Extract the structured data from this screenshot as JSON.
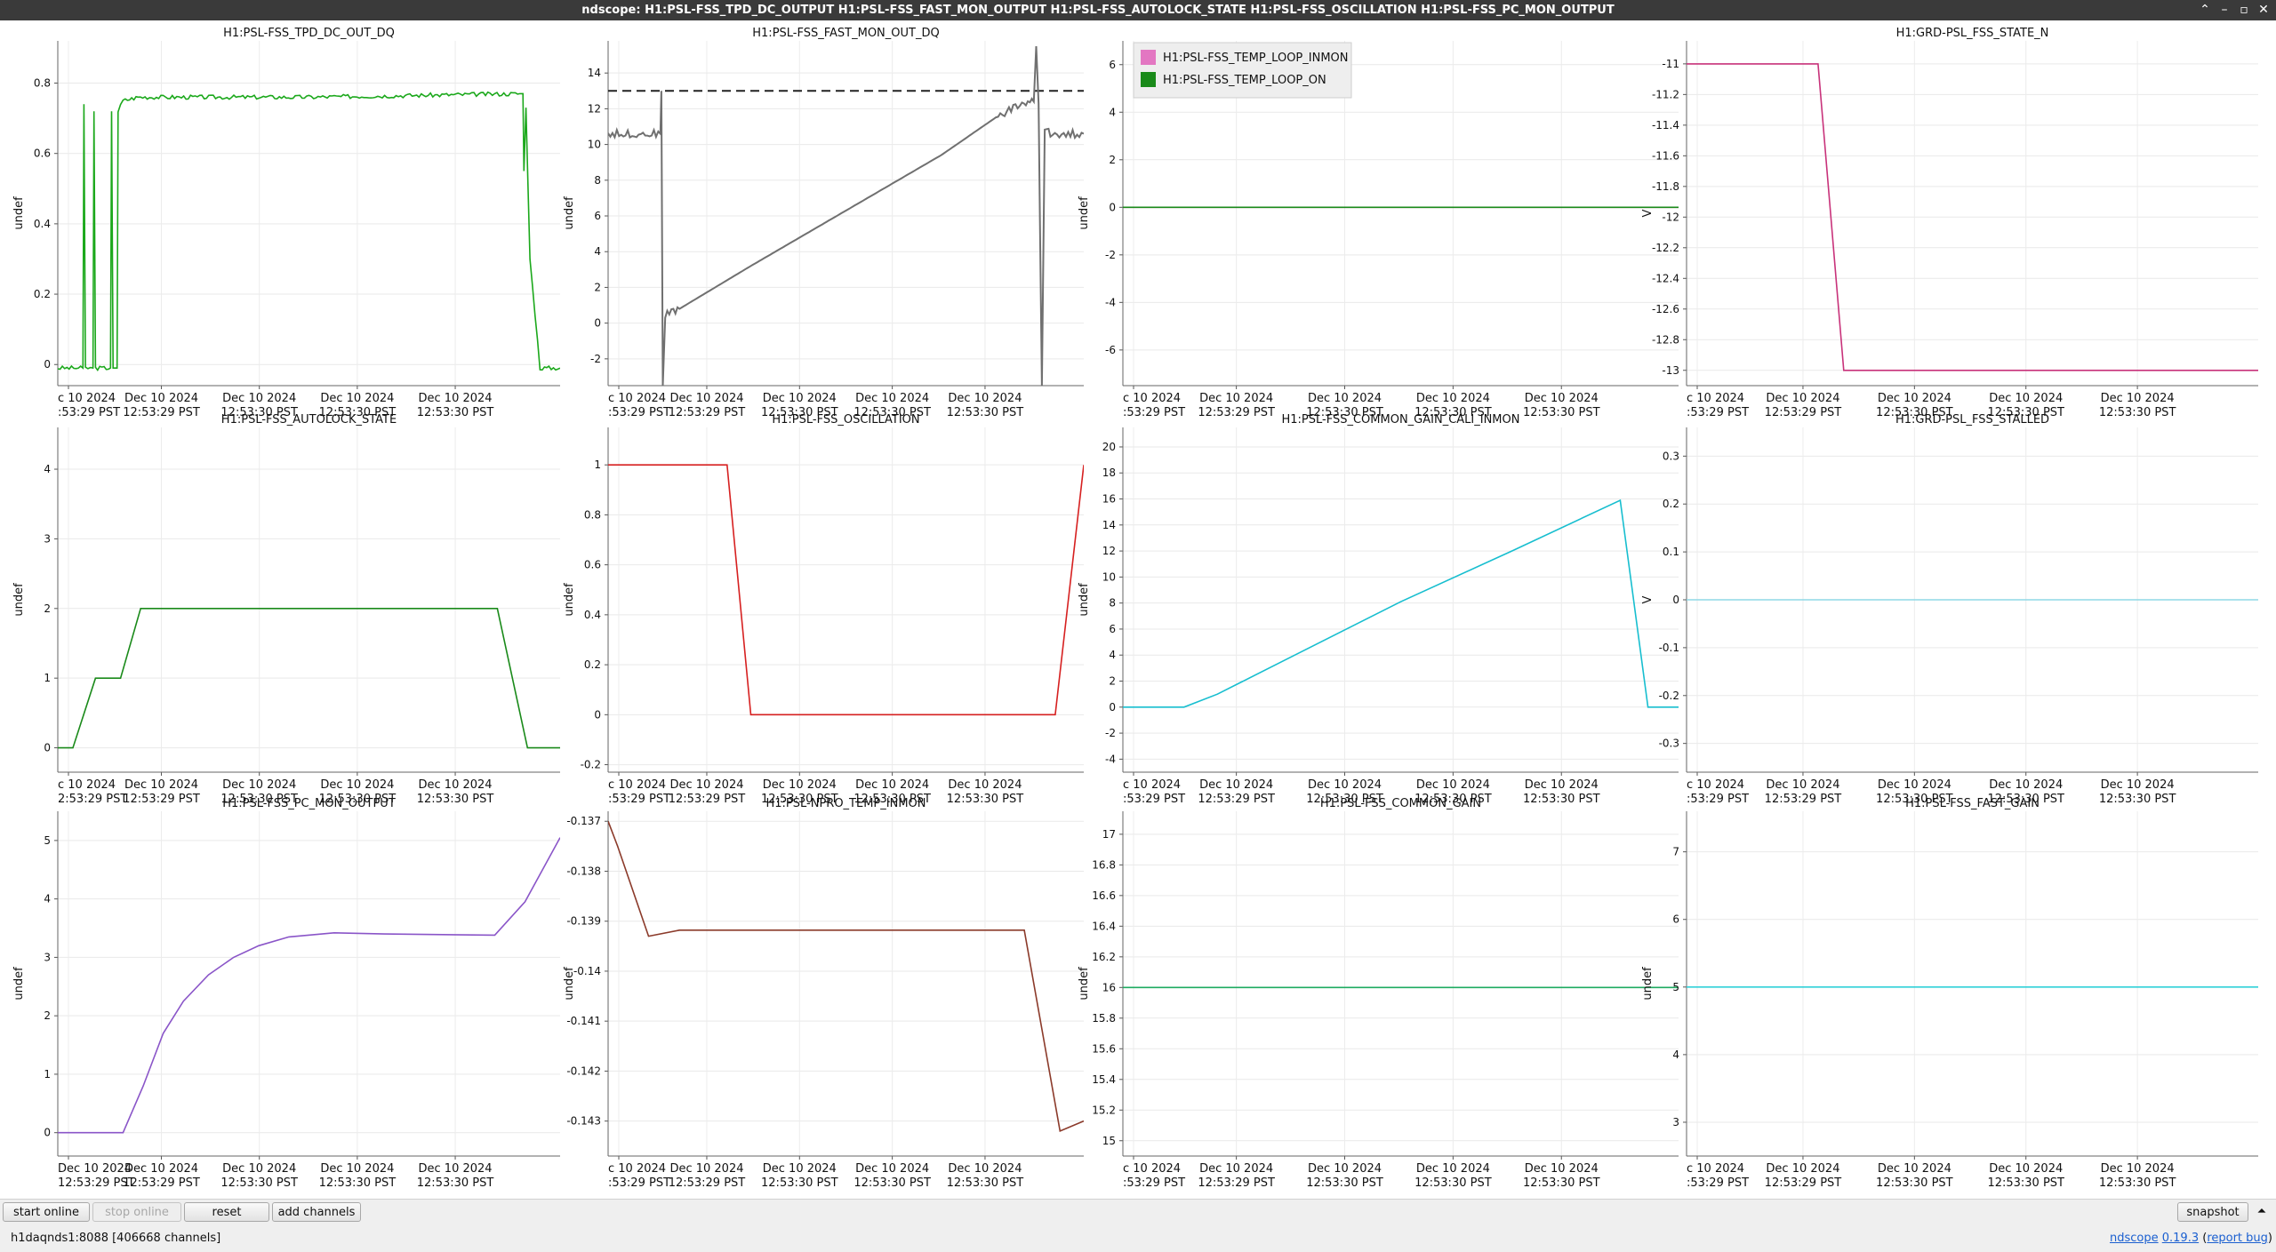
{
  "window": {
    "title": "ndscope: H1:PSL-FSS_TPD_DC_OUTPUT H1:PSL-FSS_FAST_MON_OUTPUT H1:PSL-FSS_AUTOLOCK_STATE H1:PSL-FSS_OSCILLATION H1:PSL-FSS_PC_MON_OUTPUT",
    "controls": [
      "⌃",
      "–",
      "▫",
      "✕"
    ]
  },
  "plots": [
    {
      "title": "H1:PSL-FSS_TPD_DC_OUT_DQ",
      "ylabel": "undef",
      "yrange": [
        -0.06,
        0.92
      ],
      "yticks": [
        "0",
        "0.2",
        "0.4",
        "0.6",
        "0.8"
      ],
      "xticks": [
        {
          "l1": "c 10 2024",
          "l2": ":53:29 PST"
        },
        {
          "l1": "Dec 10 2024",
          "l2": "12:53:29 PST"
        },
        {
          "l1": "Dec 10 2024",
          "l2": "12:53:30 PST"
        },
        {
          "l1": "Dec 10 2024",
          "l2": "12:53:30 PST"
        },
        {
          "l1": "Dec 10 2024",
          "l2": "12:53:30 PST"
        }
      ],
      "series": [
        {
          "color": "#1ba81b",
          "noise": 0.006,
          "points": [
            [
              0,
              -0.01
            ],
            [
              0.05,
              -0.01
            ],
            [
              0.052,
              0.74
            ],
            [
              0.055,
              -0.01
            ],
            [
              0.07,
              -0.01
            ],
            [
              0.072,
              0.72
            ],
            [
              0.075,
              -0.01
            ],
            [
              0.105,
              -0.01
            ],
            [
              0.107,
              0.72
            ],
            [
              0.11,
              -0.01
            ],
            [
              0.118,
              -0.01
            ],
            [
              0.12,
              0.72
            ],
            [
              0.13,
              0.75
            ],
            [
              0.16,
              0.76
            ],
            [
              0.5,
              0.76
            ],
            [
              0.92,
              0.77
            ],
            [
              0.926,
              0.77
            ],
            [
              0.928,
              0.55
            ],
            [
              0.932,
              0.73
            ],
            [
              0.94,
              0.3
            ],
            [
              0.96,
              -0.01
            ],
            [
              1.0,
              -0.01
            ]
          ]
        }
      ]
    },
    {
      "title": "H1:PSL-FSS_FAST_MON_OUT_DQ",
      "ylabel": "undef",
      "yrange": [
        -3.5,
        15.8
      ],
      "yticks": [
        "-2",
        "0",
        "2",
        "4",
        "6",
        "8",
        "10",
        "12",
        "14"
      ],
      "xticks": [
        {
          "l1": "c 10 2024",
          "l2": ":53:29 PST"
        },
        {
          "l1": "Dec 10 2024",
          "l2": "12:53:29 PST"
        },
        {
          "l1": "Dec 10 2024",
          "l2": "12:53:30 PST"
        },
        {
          "l1": "Dec 10 2024",
          "l2": "12:53:30 PST"
        },
        {
          "l1": "Dec 10 2024",
          "l2": "12:53:30 PST"
        }
      ],
      "hline": {
        "value": 13,
        "color": "#222222"
      },
      "series": [
        {
          "color": "#707070",
          "noise": 0.22,
          "points": [
            [
              0,
              10.6
            ],
            [
              0.11,
              10.6
            ],
            [
              0.112,
              13.0
            ],
            [
              0.115,
              -3.5
            ],
            [
              0.12,
              0.5
            ],
            [
              0.15,
              0.8
            ],
            [
              0.3,
              3.2
            ],
            [
              0.5,
              6.3
            ],
            [
              0.7,
              9.4
            ],
            [
              0.82,
              11.6
            ],
            [
              0.87,
              12.3
            ],
            [
              0.895,
              12.4
            ],
            [
              0.9,
              15.5
            ],
            [
              0.905,
              12.3
            ],
            [
              0.912,
              -3.5
            ],
            [
              0.918,
              10.9
            ],
            [
              0.93,
              10.6
            ],
            [
              1.0,
              10.6
            ]
          ]
        }
      ]
    },
    {
      "title": "",
      "ylabel": "undef",
      "yrange": [
        -7.5,
        7.0
      ],
      "yticks": [
        "-6",
        "-4",
        "-2",
        "0",
        "2",
        "4",
        "6"
      ],
      "xticks": [
        {
          "l1": "c 10 2024",
          "l2": ":53:29 PST"
        },
        {
          "l1": "Dec 10 2024",
          "l2": "12:53:29 PST"
        },
        {
          "l1": "Dec 10 2024",
          "l2": "12:53:30 PST"
        },
        {
          "l1": "Dec 10 2024",
          "l2": "12:53:30 PST"
        },
        {
          "l1": "Dec 10 2024",
          "l2": "12:53:30 PST"
        }
      ],
      "legend": [
        {
          "label": "H1:PSL-FSS_TEMP_LOOP_INMON",
          "color": "#e377c2"
        },
        {
          "label": "H1:PSL-FSS_TEMP_LOOP_ON",
          "color": "#1a8a1a"
        }
      ],
      "series": [
        {
          "color": "#e377c2",
          "noise": 0,
          "points": [
            [
              0,
              0
            ],
            [
              1,
              0
            ]
          ]
        },
        {
          "color": "#1a8a1a",
          "noise": 0,
          "points": [
            [
              0,
              0
            ],
            [
              1,
              0
            ]
          ]
        }
      ]
    },
    {
      "title": "H1:GRD-PSL_FSS_STATE_N",
      "ylabel": "V",
      "yrange": [
        -13.1,
        -10.85
      ],
      "yticks": [
        "-13",
        "-12.8",
        "-12.6",
        "-12.4",
        "-12.2",
        "-12",
        "-11.8",
        "-11.6",
        "-11.4",
        "-11.2",
        "-11"
      ],
      "xticks": [
        {
          "l1": "c 10 2024",
          "l2": ":53:29 PST"
        },
        {
          "l1": "Dec 10 2024",
          "l2": "12:53:29 PST"
        },
        {
          "l1": "Dec 10 2024",
          "l2": "12:53:30 PST"
        },
        {
          "l1": "Dec 10 2024",
          "l2": "12:53:30 PST"
        },
        {
          "l1": "Dec 10 2024",
          "l2": "12:53:30 PST"
        }
      ],
      "series": [
        {
          "color": "#c8327a",
          "noise": 0,
          "points": [
            [
              0,
              -11
            ],
            [
              0.23,
              -11
            ],
            [
              0.275,
              -13
            ],
            [
              1,
              -13
            ]
          ]
        }
      ]
    },
    {
      "title": "H1:PSL-FSS_AUTOLOCK_STATE",
      "ylabel": "undef",
      "yrange": [
        -0.35,
        4.6
      ],
      "yticks": [
        "0",
        "1",
        "2",
        "3",
        "4"
      ],
      "xticks": [
        {
          "l1": "c 10 2024",
          "l2": "2:53:29 PST"
        },
        {
          "l1": "Dec 10 2024",
          "l2": "12:53:29 PST"
        },
        {
          "l1": "Dec 10 2024",
          "l2": "12:53:30 PST"
        },
        {
          "l1": "Dec 10 2024",
          "l2": "12:53:30 PST"
        },
        {
          "l1": "Dec 10 2024",
          "l2": "12:53:30 PST"
        }
      ],
      "series": [
        {
          "color": "#1a8a1a",
          "noise": 0,
          "points": [
            [
              0,
              0
            ],
            [
              0.03,
              0
            ],
            [
              0.075,
              1
            ],
            [
              0.125,
              1
            ],
            [
              0.165,
              2
            ],
            [
              0.875,
              2
            ],
            [
              0.935,
              0
            ],
            [
              1,
              0
            ]
          ]
        }
      ]
    },
    {
      "title": "H1:PSL-FSS_OSCILLATION",
      "ylabel": "undef",
      "yrange": [
        -0.23,
        1.15
      ],
      "yticks": [
        "-0.2",
        "0",
        "0.2",
        "0.4",
        "0.6",
        "0.8",
        "1"
      ],
      "xticks": [
        {
          "l1": "c 10 2024",
          "l2": ":53:29 PST"
        },
        {
          "l1": "Dec 10 2024",
          "l2": "12:53:29 PST"
        },
        {
          "l1": "Dec 10 2024",
          "l2": "12:53:30 PST"
        },
        {
          "l1": "Dec 10 2024",
          "l2": "12:53:30 PST"
        },
        {
          "l1": "Dec 10 2024",
          "l2": "12:53:30 PST"
        }
      ],
      "series": [
        {
          "color": "#d62020",
          "noise": 0,
          "points": [
            [
              0,
              1
            ],
            [
              0.25,
              1
            ],
            [
              0.3,
              0
            ],
            [
              0.94,
              0
            ],
            [
              1,
              1
            ]
          ]
        }
      ]
    },
    {
      "title": "H1:PSL-FSS_COMMON_GAIN_CALI_INMON",
      "ylabel": "undef",
      "yrange": [
        -5,
        21.5
      ],
      "yticks": [
        "-4",
        "-2",
        "0",
        "2",
        "4",
        "6",
        "8",
        "10",
        "12",
        "14",
        "16",
        "18",
        "20"
      ],
      "xticks": [
        {
          "l1": "c 10 2024",
          "l2": ":53:29 PST"
        },
        {
          "l1": "Dec 10 2024",
          "l2": "12:53:29 PST"
        },
        {
          "l1": "Dec 10 2024",
          "l2": "12:53:30 PST"
        },
        {
          "l1": "Dec 10 2024",
          "l2": "12:53:30 PST"
        },
        {
          "l1": "Dec 10 2024",
          "l2": "12:53:30 PST"
        }
      ],
      "series": [
        {
          "color": "#17becf",
          "noise": 0,
          "points": [
            [
              0,
              0
            ],
            [
              0.11,
              0
            ],
            [
              0.17,
              1
            ],
            [
              0.3,
              3.8
            ],
            [
              0.5,
              8.1
            ],
            [
              0.7,
              12
            ],
            [
              0.895,
              15.9
            ],
            [
              0.945,
              0
            ],
            [
              1,
              0
            ]
          ]
        }
      ]
    },
    {
      "title": "H1:GRD-PSL_FSS_STALLED",
      "ylabel": "V",
      "yrange": [
        -0.36,
        0.36
      ],
      "yticks": [
        "-0.3",
        "-0.2",
        "-0.1",
        "0",
        "0.1",
        "0.2",
        "0.3"
      ],
      "xticks": [
        {
          "l1": "c 10 2024",
          "l2": ":53:29 PST"
        },
        {
          "l1": "Dec 10 2024",
          "l2": "12:53:29 PST"
        },
        {
          "l1": "Dec 10 2024",
          "l2": "12:53:30 PST"
        },
        {
          "l1": "Dec 10 2024",
          "l2": "12:53:30 PST"
        },
        {
          "l1": "Dec 10 2024",
          "l2": "12:53:30 PST"
        }
      ],
      "series": [
        {
          "color": "#8fd8e6",
          "noise": 0,
          "points": [
            [
              0,
              0
            ],
            [
              1,
              0
            ]
          ]
        }
      ]
    },
    {
      "title": "H1:PSL-FSS_PC_MON_OUTPUT",
      "ylabel": "undef",
      "yrange": [
        -0.4,
        5.5
      ],
      "yticks": [
        "0",
        "1",
        "2",
        "3",
        "4",
        "5"
      ],
      "xticks": [
        {
          "l1": "Dec 10 2024",
          "l2": "12:53:29 PST"
        },
        {
          "l1": "Dec 10 2024",
          "l2": "12:53:29 PST"
        },
        {
          "l1": "Dec 10 2024",
          "l2": "12:53:30 PST"
        },
        {
          "l1": "Dec 10 2024",
          "l2": "12:53:30 PST"
        },
        {
          "l1": "Dec 10 2024",
          "l2": "12:53:30 PST"
        }
      ],
      "series": [
        {
          "color": "#8a55c8",
          "noise": 0,
          "points": [
            [
              0,
              0
            ],
            [
              0.13,
              0
            ],
            [
              0.17,
              0.8
            ],
            [
              0.21,
              1.7
            ],
            [
              0.25,
              2.25
            ],
            [
              0.3,
              2.7
            ],
            [
              0.35,
              3.0
            ],
            [
              0.4,
              3.2
            ],
            [
              0.46,
              3.35
            ],
            [
              0.55,
              3.42
            ],
            [
              0.65,
              3.4
            ],
            [
              0.87,
              3.38
            ],
            [
              0.93,
              3.95
            ],
            [
              1,
              5.05
            ]
          ]
        }
      ]
    },
    {
      "title": "H1:PSL-NPRO_TEMP_INMON",
      "ylabel": "undef",
      "yrange": [
        -0.1437,
        -0.1368
      ],
      "yticks": [
        "-0.143",
        "-0.142",
        "-0.141",
        "-0.14",
        "-0.139",
        "-0.138",
        "-0.137"
      ],
      "xticks": [
        {
          "l1": "c 10 2024",
          "l2": ":53:29 PST"
        },
        {
          "l1": "Dec 10 2024",
          "l2": "12:53:29 PST"
        },
        {
          "l1": "Dec 10 2024",
          "l2": "12:53:30 PST"
        },
        {
          "l1": "Dec 10 2024",
          "l2": "12:53:30 PST"
        },
        {
          "l1": "Dec 10 2024",
          "l2": "12:53:30 PST"
        }
      ],
      "series": [
        {
          "color": "#8b3a2a",
          "noise": 0,
          "points": [
            [
              0,
              -0.137
            ],
            [
              0.02,
              -0.1375
            ],
            [
              0.085,
              -0.1393
            ],
            [
              0.15,
              -0.13918
            ],
            [
              0.5,
              -0.13918
            ],
            [
              0.875,
              -0.13918
            ],
            [
              0.95,
              -0.1432
            ],
            [
              1.0,
              -0.143
            ]
          ]
        }
      ]
    },
    {
      "title": "H1:PSL-FSS_COMMON_GAIN",
      "ylabel": "undef",
      "yrange": [
        14.9,
        17.15
      ],
      "yticks": [
        "15",
        "15.2",
        "15.4",
        "15.6",
        "15.8",
        "16",
        "16.2",
        "16.4",
        "16.6",
        "16.8",
        "17"
      ],
      "xticks": [
        {
          "l1": "c 10 2024",
          "l2": ":53:29 PST"
        },
        {
          "l1": "Dec 10 2024",
          "l2": "12:53:29 PST"
        },
        {
          "l1": "Dec 10 2024",
          "l2": "12:53:30 PST"
        },
        {
          "l1": "Dec 10 2024",
          "l2": "12:53:30 PST"
        },
        {
          "l1": "Dec 10 2024",
          "l2": "12:53:30 PST"
        }
      ],
      "series": [
        {
          "color": "#1dab60",
          "noise": 0,
          "points": [
            [
              0,
              16
            ],
            [
              1,
              16
            ]
          ]
        }
      ]
    },
    {
      "title": "H1:PSL-FSS_FAST_GAIN",
      "ylabel": "undef",
      "yrange": [
        2.5,
        7.6
      ],
      "yticks": [
        "3",
        "4",
        "5",
        "6",
        "7"
      ],
      "xticks": [
        {
          "l1": "c 10 2024",
          "l2": ":53:29 PST"
        },
        {
          "l1": "Dec 10 2024",
          "l2": "12:53:29 PST"
        },
        {
          "l1": "Dec 10 2024",
          "l2": "12:53:30 PST"
        },
        {
          "l1": "Dec 10 2024",
          "l2": "12:53:30 PST"
        },
        {
          "l1": "Dec 10 2024",
          "l2": "12:53:30 PST"
        }
      ],
      "series": [
        {
          "color": "#30d0d8",
          "noise": 0,
          "points": [
            [
              0,
              5
            ],
            [
              1,
              5
            ]
          ]
        }
      ]
    }
  ],
  "toolbar": {
    "start_online": "start online",
    "stop_online": "stop online",
    "reset": "reset",
    "add_channels": "add channels",
    "snapshot": "snapshot",
    "menu_arrow": "⏶"
  },
  "status": {
    "server": "h1daqnds1:8088  [406668 channels]",
    "app": "ndscope",
    "version": "0.19.3",
    "report_open": "(",
    "report_bug": "report bug",
    "report_close": ")"
  }
}
